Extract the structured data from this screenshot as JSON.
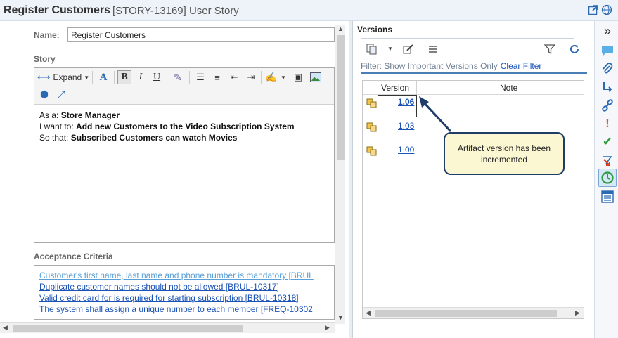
{
  "title": {
    "name": "Register Customers",
    "id_type": "[STORY-13169] User Story"
  },
  "left": {
    "name_label": "Name:",
    "name_value": "Register Customers",
    "story_label": "Story",
    "toolbar": {
      "expand_label": "Expand"
    },
    "story_lines": [
      {
        "label": "As a:",
        "value": "Store Manager"
      },
      {
        "label": "I want to:",
        "value": "Add new Customers to the Video Subscription System"
      },
      {
        "label": "So that:",
        "value": "Subscribed Customers can watch Movies"
      }
    ],
    "ac_label": "Acceptance Criteria",
    "ac_items": [
      "Customer's first name, last name and phone number is mandatory [BRUL",
      "Duplicate customer names should not be allowed [BRUL-10317]",
      "Valid credit card for is required for starting subscription [BRUL-10318]",
      "The system shall assign a unique number to each member [FREQ-10302"
    ]
  },
  "versions": {
    "title": "Versions",
    "filter_text": "Filter: Show Important Versions Only",
    "clear_filter": "Clear Filter",
    "columns": [
      "Version",
      "Note"
    ],
    "rows": [
      {
        "version": "1.06",
        "selected": true
      },
      {
        "version": "1.03",
        "selected": false
      },
      {
        "version": "1.00",
        "selected": false
      }
    ],
    "callout": "Artifact version has been incremented"
  },
  "colors": {
    "link": "#1a52b5",
    "accent": "#4a7fb6",
    "callout_bg": "#fbf7d2",
    "callout_border": "#1f3c68"
  }
}
